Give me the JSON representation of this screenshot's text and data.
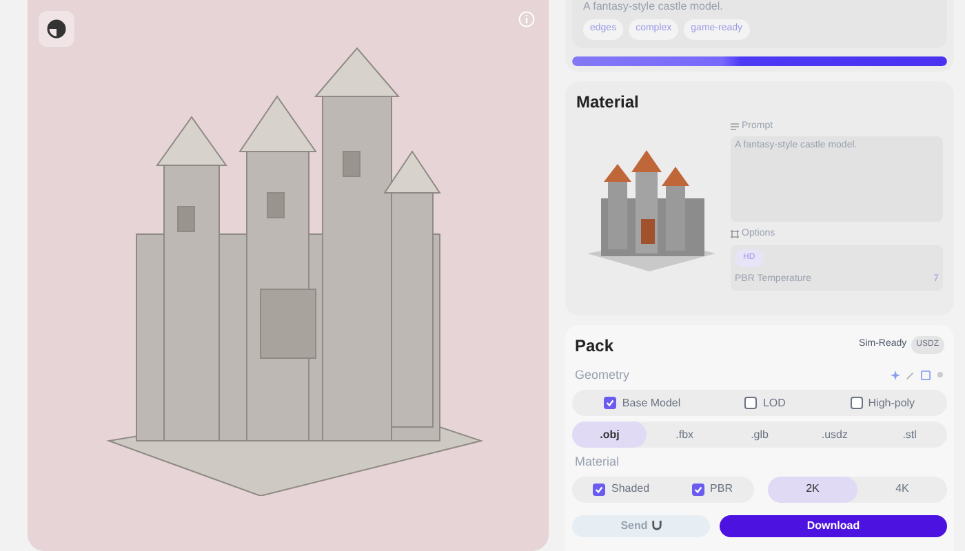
{
  "prompt_card": {
    "text": "A fantasy-style castle model.",
    "tags": [
      "edges",
      "complex",
      "game-ready"
    ],
    "progress": {
      "level": 1
    }
  },
  "material": {
    "title": "Material",
    "prompt_label": "Prompt",
    "prompt": "A fantasy-style castle model.",
    "options_label": "Options",
    "option_chip": "HD",
    "temperature_label": "PBR Temperature",
    "temperature_value": "7"
  },
  "pack": {
    "title": "Pack",
    "sim_ready": "Sim-Ready",
    "badge": "USDZ",
    "geometry_label": "Geometry",
    "geometry_options": [
      {
        "label": "Base Model",
        "checked": true
      },
      {
        "label": "LOD",
        "checked": false
      },
      {
        "label": "High-poly",
        "checked": false
      }
    ],
    "formats": [
      {
        "label": ".obj",
        "selected": true
      },
      {
        "label": ".fbx",
        "selected": false
      },
      {
        "label": ".glb",
        "selected": false
      },
      {
        "label": ".usdz",
        "selected": false
      },
      {
        "label": ".stl",
        "selected": false
      }
    ],
    "material_label": "Material",
    "material_options": [
      {
        "label": "Shaded",
        "checked": true
      },
      {
        "label": "PBR",
        "checked": true
      }
    ],
    "resolutions": [
      {
        "label": "2K",
        "selected": true
      },
      {
        "label": "4K",
        "selected": false
      }
    ],
    "send": "Send",
    "download": "Download"
  }
}
